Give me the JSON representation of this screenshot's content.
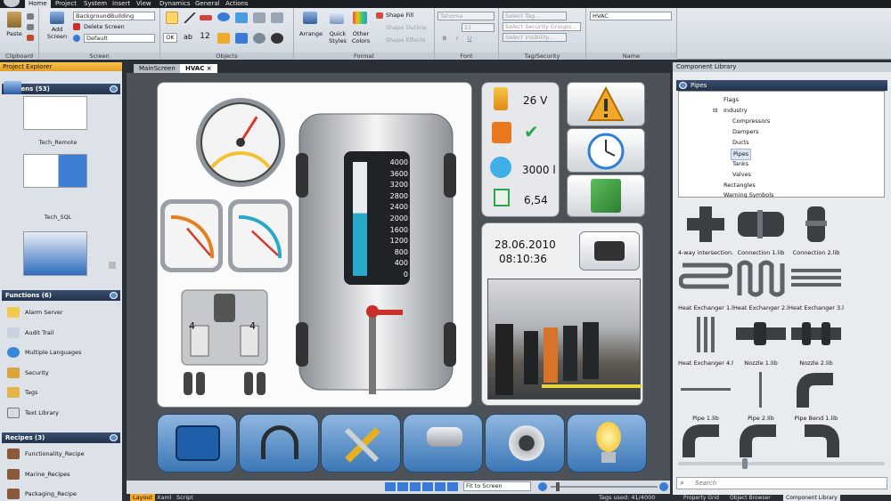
{
  "menu": {
    "items": [
      "Home",
      "Project",
      "System",
      "Insert",
      "View",
      "Dynamics",
      "General",
      "Actions"
    ]
  },
  "ribbon": {
    "clipboard": {
      "label": "Clipboard",
      "paste": "Paste"
    },
    "screen": {
      "label": "Screen",
      "add_screen": "Add Screen",
      "bg_screen": "BackgroundBuilding",
      "delete_screen": "Delete Screen",
      "default": "Default"
    },
    "objects": {
      "label": "Objects",
      "ok": "OK",
      "ab": "ab",
      "num": "12"
    },
    "format": {
      "label": "Format",
      "arrange": "Arrange",
      "quick_styles": "Quick Styles",
      "other_colors": "Other Colors",
      "shape_fill": "Shape Fill",
      "shape_outline": "Shape Outline",
      "shape_effects": "Shape Effects"
    },
    "font": {
      "label": "Font",
      "font_name": "Tahoma",
      "font_size": "11",
      "bold": "B",
      "italic": "I",
      "underline": "U"
    },
    "tag_security": {
      "label": "Tag/Security",
      "select_tag": "Select Tag...",
      "select_groups": "Select Security Groups...",
      "select_visibility": "Select Visibility..."
    },
    "name": {
      "label": "Name",
      "value": "HVAC"
    }
  },
  "project_explorer": {
    "title": "Project Explorer",
    "screens_header": "Screens (53)",
    "screens": [
      "Tech_Remote",
      "Tech_SQL"
    ],
    "functions_header": "Functions (6)",
    "functions": [
      "Alarm Server",
      "Audit Trail",
      "Multiple Languages",
      "Security",
      "Tags",
      "Text Library"
    ],
    "recipes_header": "Recipes (3)",
    "recipes": [
      "Functionality_Recipe",
      "Marine_Recipes",
      "Packaging_Recipe"
    ]
  },
  "doc_tabs": [
    "MainScreen",
    "HVAC"
  ],
  "hmi": {
    "tank_scale": [
      "4000",
      "3600",
      "3200",
      "2800",
      "2400",
      "2000",
      "1600",
      "1200",
      "800",
      "400",
      "0"
    ],
    "tank_level": 0.55,
    "voltage": "26 V",
    "volume": "3000 l",
    "ratio": "6,54",
    "date": "28.06.2010",
    "time": "08:10:36",
    "gauge_big_value": 0.62,
    "gauge_left_value": 0.55,
    "gauge_right_value": 0.48
  },
  "component_library": {
    "title": "Component Library",
    "category": "Pipes",
    "tree": [
      "Flags",
      "Industry",
      "Compressors",
      "Dampers",
      "Ducts",
      "Pipes",
      "Tanks",
      "Valves",
      "Rectangles",
      "Warning Symbols"
    ],
    "items": [
      "4-way intersection.",
      "Connection 1.lib",
      "Connection 2.lib",
      "Heat Exchanger 1.l",
      "Heat Exchanger 2.l",
      "Heat Exchanger 3.l",
      "Heat Exchanger 4.l",
      "Nozzle 1.lib",
      "Nozzle 2.lib",
      "Pipe 1.lib",
      "Pipe 2.lib",
      "Pipe Bend 1.lib"
    ],
    "search_placeholder": "Search"
  },
  "status": {
    "zoom": "Fit to Screen",
    "tags_used": "Tags used: 41/4000",
    "view_tabs": [
      "Layout",
      "Xaml",
      "Script"
    ]
  },
  "bottom_tabs": [
    "Property Grid",
    "Object Browser",
    "Component Library"
  ],
  "colors": {
    "accent": "#f0a92a",
    "tank_fill": "#29a9c9",
    "dark": "#2b2f36"
  }
}
